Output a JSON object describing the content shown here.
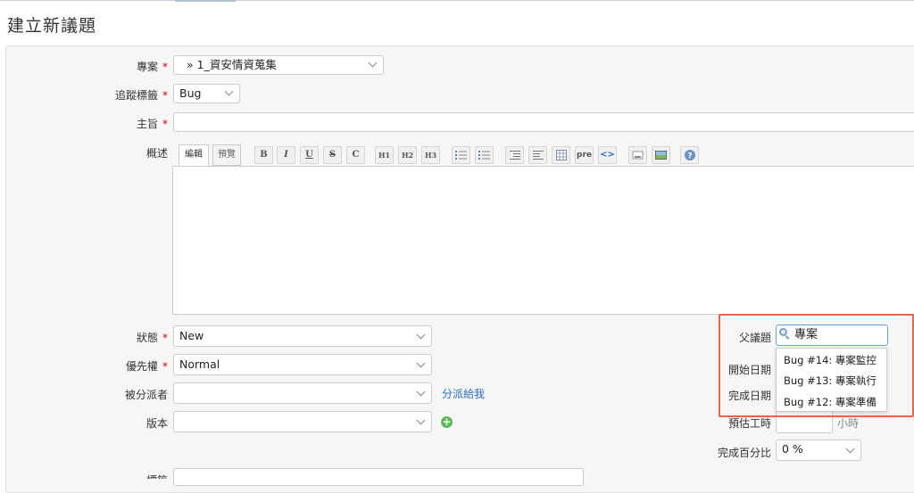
{
  "page": {
    "title": "建立新議題"
  },
  "form": {
    "project": {
      "label": "專案",
      "value": "» 1_資安情資蒐集"
    },
    "tracker": {
      "label": "追蹤標籤",
      "value": "Bug"
    },
    "subject": {
      "label": "主旨",
      "value": ""
    },
    "description": {
      "label": "概述",
      "tabs": [
        "編輯",
        "預覽"
      ],
      "toolbar": [
        "B",
        "I",
        "U",
        "S",
        "C",
        "H1",
        "H2",
        "H3",
        "ul",
        "ol",
        "left",
        "right",
        "table",
        "pre",
        "code",
        "link",
        "image",
        "help"
      ]
    },
    "status": {
      "label": "狀態",
      "value": "New"
    },
    "priority": {
      "label": "優先權",
      "value": "Normal"
    },
    "assignee": {
      "label": "被分派者",
      "value": "",
      "assign_to_me": "分派給我"
    },
    "version": {
      "label": "版本",
      "value": ""
    },
    "parent": {
      "label": "父議題",
      "value": "專案"
    },
    "start_date": {
      "label": "開始日期"
    },
    "due_date": {
      "label": "完成日期"
    },
    "estimated": {
      "label": "預估工時",
      "unit": "小時"
    },
    "done_ratio": {
      "label": "完成百分比",
      "value": "0 %"
    },
    "partial_label": "標籤"
  },
  "autocomplete": [
    "Bug #14: 專案監控",
    "Bug #13: 專案執行",
    "Bug #12: 專案準備"
  ],
  "colors": {
    "required": "#cc0000",
    "highlight": "#e8644a",
    "link": "#2a6ebb"
  }
}
